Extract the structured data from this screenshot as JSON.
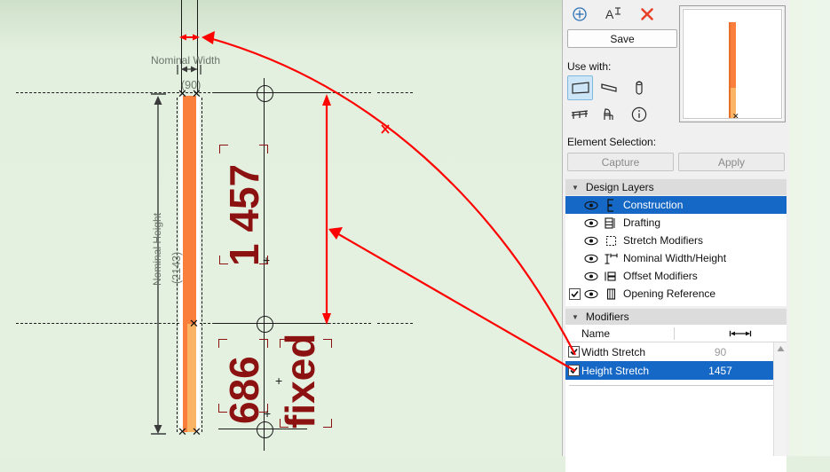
{
  "canvas": {
    "dimension_labels": {
      "nominal_width": "Nominal Width",
      "nominal_width_value": "(90)",
      "nominal_height": "Nominal Height",
      "nominal_height_value": "(2143)"
    },
    "modifier_labels": {
      "height_stretch_value": "1 457",
      "lower_segment_value": "686",
      "lower_segment_name": "fixed"
    },
    "colors": {
      "background": "#E3F0DF",
      "element_upper": "#FB7F3C",
      "element_lower": "#FBB463",
      "annotation": "#FF0000",
      "modifier_text": "#8C1111"
    }
  },
  "panel": {
    "toolbar": {
      "add_label": "+",
      "rename_label": "A",
      "delete_label": "✕",
      "icons": [
        "add-icon",
        "rename-icon",
        "delete-icon"
      ]
    },
    "save_label": "Save",
    "use_with": {
      "label": "Use with:",
      "items": [
        {
          "name": "wall-icon",
          "selected": true
        },
        {
          "name": "slab-icon",
          "selected": false
        },
        {
          "name": "column-icon",
          "selected": false
        },
        {
          "name": "railing-icon",
          "selected": false
        },
        {
          "name": "furniture-icon",
          "selected": false
        },
        {
          "name": "info-icon",
          "selected": false
        }
      ]
    },
    "element_selection": {
      "label": "Element Selection:",
      "capture_label": "Capture",
      "apply_label": "Apply"
    },
    "design_layers": {
      "header": "Design Layers",
      "items": [
        {
          "label": "Construction",
          "selected": true,
          "checked": false,
          "visible": true,
          "icon": "construction-layer-icon"
        },
        {
          "label": "Drafting",
          "selected": false,
          "checked": false,
          "visible": true,
          "icon": "drafting-layer-icon"
        },
        {
          "label": "Stretch Modifiers",
          "selected": false,
          "checked": false,
          "visible": true,
          "icon": "stretch-modifiers-layer-icon"
        },
        {
          "label": "Nominal Width/Height",
          "selected": false,
          "checked": false,
          "visible": true,
          "icon": "nominal-dimensions-layer-icon"
        },
        {
          "label": "Offset Modifiers",
          "selected": false,
          "checked": false,
          "visible": true,
          "icon": "offset-modifiers-layer-icon"
        },
        {
          "label": "Opening Reference",
          "selected": false,
          "checked": true,
          "visible": true,
          "icon": "opening-reference-layer-icon"
        }
      ]
    },
    "modifiers": {
      "header": "Modifiers",
      "columns": {
        "name": "Name",
        "dimension_icon": "dimension-arrow-icon"
      },
      "rows": [
        {
          "label": "Width Stretch",
          "value": "90",
          "checked": true,
          "selected": false,
          "dimmed": true
        },
        {
          "label": "Height Stretch",
          "value": "1457",
          "checked": true,
          "selected": true,
          "dimmed": false
        }
      ]
    }
  }
}
